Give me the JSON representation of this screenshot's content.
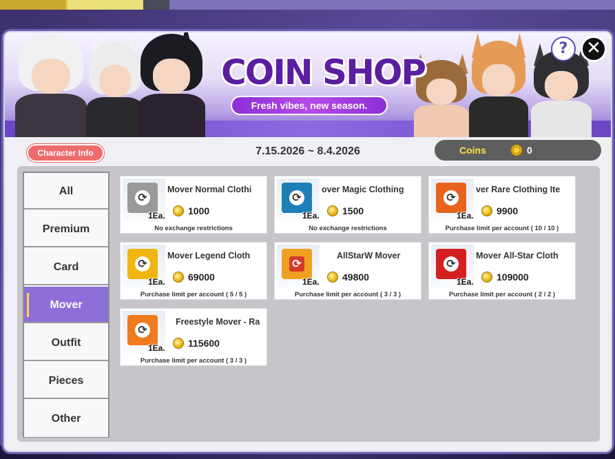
{
  "shop": {
    "title": "COIN SHOP",
    "subtitle": "Fresh vibes, new season.",
    "help_label": "?",
    "close_label": "✕",
    "character_info_label": "Character Info",
    "date_range": "7.15.2026 ~ 8.4.2026",
    "coins_label": "Coins",
    "coins_value": "0",
    "accent_color": "#8e6ed8",
    "coin_icon": "gold-coin-icon"
  },
  "sidebar": {
    "items": [
      {
        "label": "All"
      },
      {
        "label": "Premium"
      },
      {
        "label": "Card"
      },
      {
        "label": "Mover",
        "active": true
      },
      {
        "label": "Outfit"
      },
      {
        "label": "Pieces"
      },
      {
        "label": "Other"
      }
    ]
  },
  "items": [
    {
      "name": "Mover    Normal Clothi",
      "price": "1000",
      "qty": "1Ea.",
      "limit": "No exchange restrictions",
      "color": "#9a9a9a",
      "icon": "mover-ticket-icon"
    },
    {
      "name": "over    Magic Clothing",
      "price": "1500",
      "qty": "1Ea.",
      "limit": "No exchange restrictions",
      "color": "#1e7fb8",
      "icon": "mover-ticket-icon"
    },
    {
      "name": "ver    Rare Clothing Ite",
      "price": "9900",
      "qty": "1Ea.",
      "limit": "Purchase limit per account ( 10 / 10 )",
      "color": "#e8641e",
      "icon": "mover-ticket-icon"
    },
    {
      "name": "Mover    Legend Cloth",
      "price": "69000",
      "qty": "1Ea.",
      "limit": "Purchase limit per account ( 5 / 5 )",
      "color": "#f0b510",
      "icon": "mover-ticket-icon"
    },
    {
      "name": "AllStarW Mover",
      "price": "49800",
      "qty": "1Ea.",
      "limit": "Purchase limit per account ( 3 / 3 )",
      "color": "#f0a020",
      "icon": "card-mover-icon"
    },
    {
      "name": "Mover    All-Star Cloth",
      "price": "109000",
      "qty": "1Ea.",
      "limit": "Purchase limit per account ( 2 / 2 )",
      "color": "#d42020",
      "icon": "mover-ticket-icon"
    },
    {
      "name": "Freestyle Mover - Ra",
      "price": "115600",
      "qty": "1Ea.",
      "limit": "Purchase limit per account ( 3 / 3 )",
      "color": "#f07a1e",
      "icon": "freestyle-mover-icon"
    }
  ]
}
